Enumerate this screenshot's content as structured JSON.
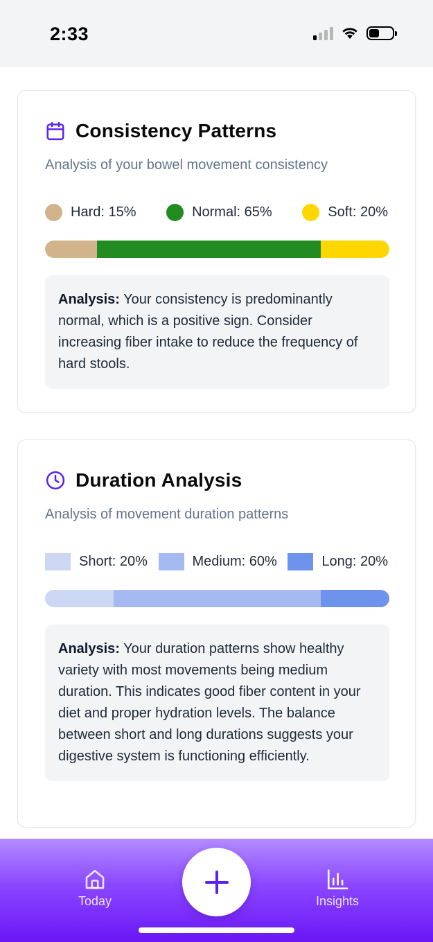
{
  "status_bar": {
    "time": "2:33"
  },
  "consistency": {
    "title": "Consistency Patterns",
    "subtitle": "Analysis of your bowel movement consistency",
    "icon": "calendar-icon",
    "accent": "#5b21f0",
    "legend": [
      {
        "label": "Hard: 15%",
        "color": "#d2b48c",
        "value": 15
      },
      {
        "label": "Normal: 65%",
        "color": "#228b22",
        "value": 65
      },
      {
        "label": "Soft: 20%",
        "color": "#ffd700",
        "value": 20
      }
    ],
    "analysis_label": "Analysis:",
    "analysis_text": " Your consistency is predominantly normal, which is a positive sign. Consider increasing fiber intake to reduce the frequency of hard stools."
  },
  "duration": {
    "title": "Duration Analysis",
    "subtitle": "Analysis of movement duration patterns",
    "icon": "clock-icon",
    "accent": "#5b21f0",
    "legend": [
      {
        "label": "Short: 20%",
        "color": "#ccd7f4",
        "value": 20
      },
      {
        "label": "Medium: 60%",
        "color": "#a5baf1",
        "value": 60
      },
      {
        "label": "Long: 20%",
        "color": "#6e93ec",
        "value": 20
      }
    ],
    "analysis_label": "Analysis:",
    "analysis_text": " Your duration patterns show healthy variety with most movements being medium duration. This indicates good fiber content in your diet and proper hydration levels. The balance between short and long durations suggests your digestive system is functioning efficiently."
  },
  "tab_bar": {
    "today_label": "Today",
    "insights_label": "Insights",
    "add_icon": "plus-icon",
    "gradient": [
      "#b38cff",
      "#6a16f5"
    ]
  }
}
